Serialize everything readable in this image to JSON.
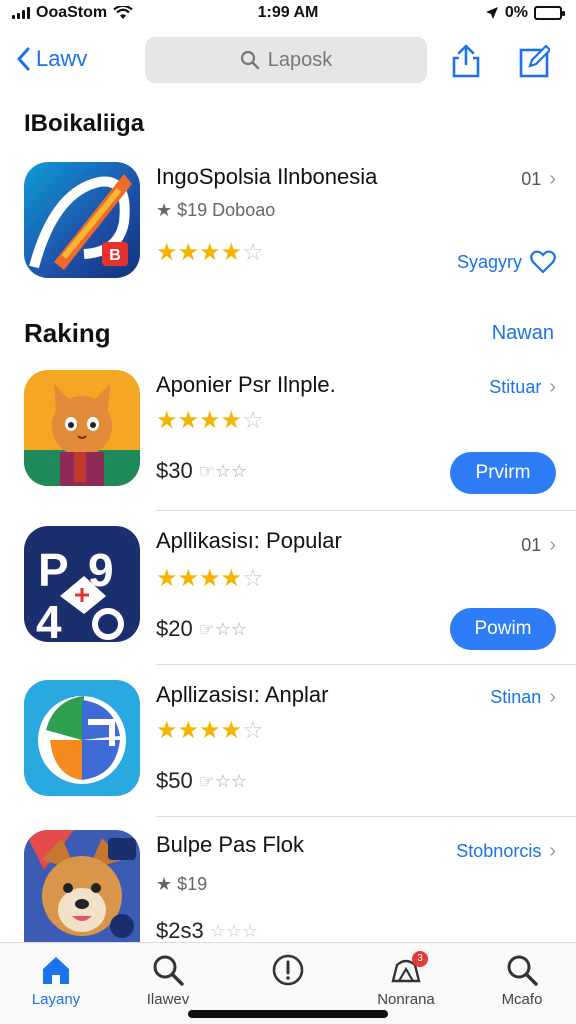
{
  "status": {
    "carrier": "OoaStom",
    "time": "1:99 AM",
    "battery": "0%"
  },
  "nav": {
    "back_label": "Lawv",
    "search_placeholder": "Laposk"
  },
  "featured": {
    "title": "IBoikaliiga",
    "app": {
      "name": "IngoSpolsia Ilnbonesia",
      "rating_text": "$19 Doboao",
      "stars": 4,
      "meta": "01",
      "wishlist_label": "Syagyry"
    }
  },
  "ranking": {
    "title": "Raking",
    "see_all": "Nawan",
    "apps": [
      {
        "name": "Aponier Psr Ilnple.",
        "stars": 4,
        "price": "$30",
        "link": "Stituar",
        "button": "Prvirm"
      },
      {
        "name": "Apllikasisı: Popular",
        "stars": 4,
        "price": "$20",
        "link": "01",
        "button": "Powim"
      },
      {
        "name": "Apllizasisı: Anplar",
        "stars": 4,
        "price": "$50",
        "link": "Stinan",
        "button": ""
      },
      {
        "name": "Bulpe Pas Flok",
        "stars": 0,
        "rating_text": "$19",
        "price": "$2s3",
        "link": "Stobnorcis",
        "button": ""
      }
    ]
  },
  "tabs": [
    {
      "label": "Layany",
      "icon": "home-icon",
      "active": true
    },
    {
      "label": "Ilawev",
      "icon": "search-icon",
      "active": false
    },
    {
      "label": "",
      "icon": "compass-icon",
      "active": false
    },
    {
      "label": "Nonrana",
      "icon": "notification-icon",
      "active": false,
      "badge": "3"
    },
    {
      "label": "Mcafo",
      "icon": "search-icon",
      "active": false
    }
  ],
  "colors": {
    "accent": "#1a73e8",
    "button": "#2f7df6",
    "star": "#f4b400"
  }
}
